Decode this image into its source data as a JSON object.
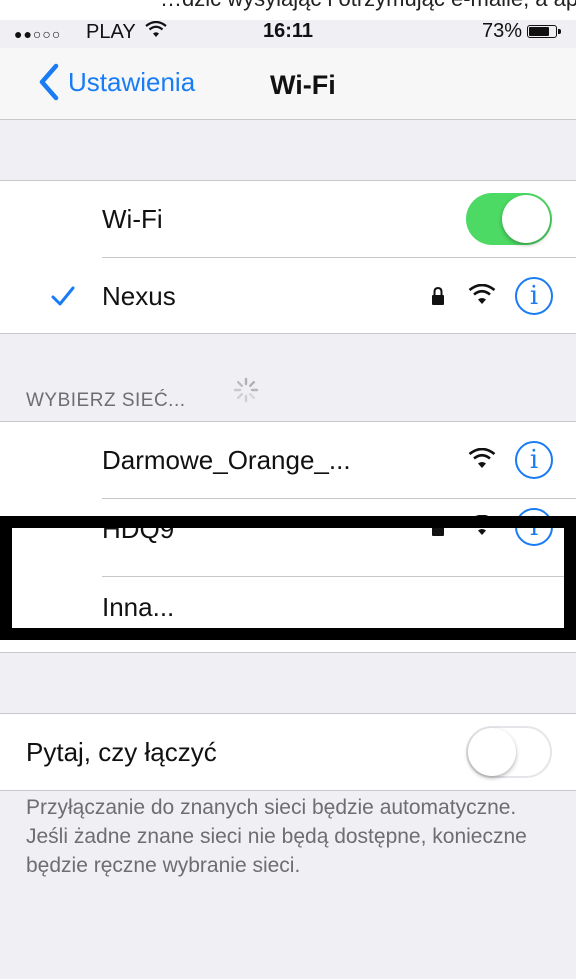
{
  "status_bar": {
    "signal_dots": "●●○○○",
    "carrier": "PLAY",
    "time": "16:11",
    "battery_percent": "73%",
    "battery_level": 0.73
  },
  "top_clipped_text": "…dzic wysylając i otrzymując e-maile, a aplikacja…",
  "nav": {
    "back_label": "Ustawienia",
    "title": "Wi-Fi"
  },
  "wifi": {
    "label": "Wi-Fi",
    "enabled": true
  },
  "connected_network": {
    "name": "Nexus",
    "secured": true
  },
  "choose_network": {
    "header": "WYBIERZ SIEĆ..."
  },
  "networks": [
    {
      "name": "Darmowe_Orange_...",
      "secured": false
    },
    {
      "name": "HDQ9",
      "secured": true
    }
  ],
  "other_network": {
    "label": "Inna..."
  },
  "ask_to_join": {
    "label": "Pytaj, czy łączyć",
    "enabled": false
  },
  "footer_text": "Przyłączanie do znanych sieci będzie automatyczne. Jeśli żadne znane sieci nie będą dostępne, konieczne będzie ręczne wybranie sieci.",
  "colors": {
    "accent": "#1a7cf5",
    "toggle_on": "#4cd964",
    "background": "#efeff4"
  },
  "icons": {
    "info": "i",
    "checkmark": "checkmark-icon",
    "lock": "lock-icon",
    "wifi": "wifi-icon"
  }
}
